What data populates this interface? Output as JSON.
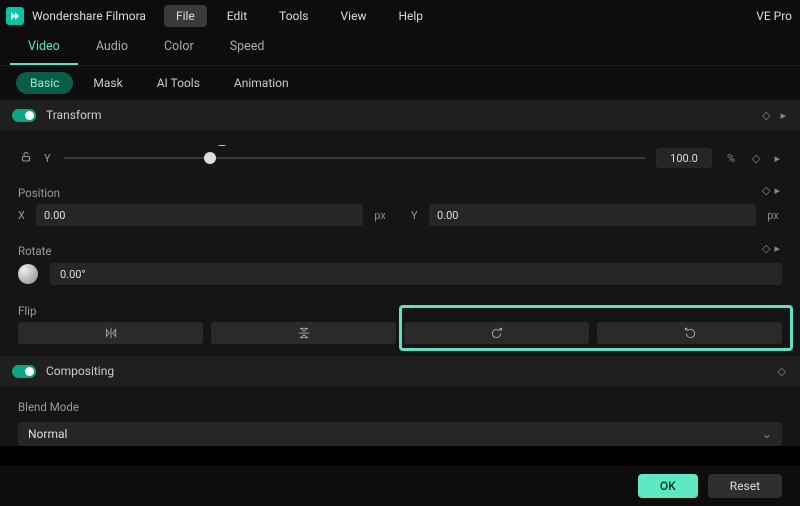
{
  "app": {
    "title": "Wondershare Filmora",
    "right_text": "VE Pro"
  },
  "menu": {
    "file": "File",
    "edit": "Edit",
    "tools": "Tools",
    "view": "View",
    "help": "Help"
  },
  "tabs_primary": {
    "video": "Video",
    "audio": "Audio",
    "color": "Color",
    "speed": "Speed"
  },
  "tabs_secondary": {
    "basic": "Basic",
    "mask": "Mask",
    "ai_tools": "AI Tools",
    "animation": "Animation"
  },
  "sections": {
    "transform": "Transform",
    "compositing": "Compositing"
  },
  "scale": {
    "y_label": "Y",
    "y_value": "100.0",
    "y_unit": "%"
  },
  "position": {
    "label": "Position",
    "x_label": "X",
    "x_value": "0.00",
    "x_unit": "px",
    "y_label": "Y",
    "y_value": "0.00",
    "y_unit": "px"
  },
  "rotate": {
    "label": "Rotate",
    "value": "0.00°"
  },
  "flip": {
    "label": "Flip"
  },
  "blend": {
    "label": "Blend Mode",
    "value": "Normal"
  },
  "buttons": {
    "ok": "OK",
    "reset": "Reset"
  }
}
